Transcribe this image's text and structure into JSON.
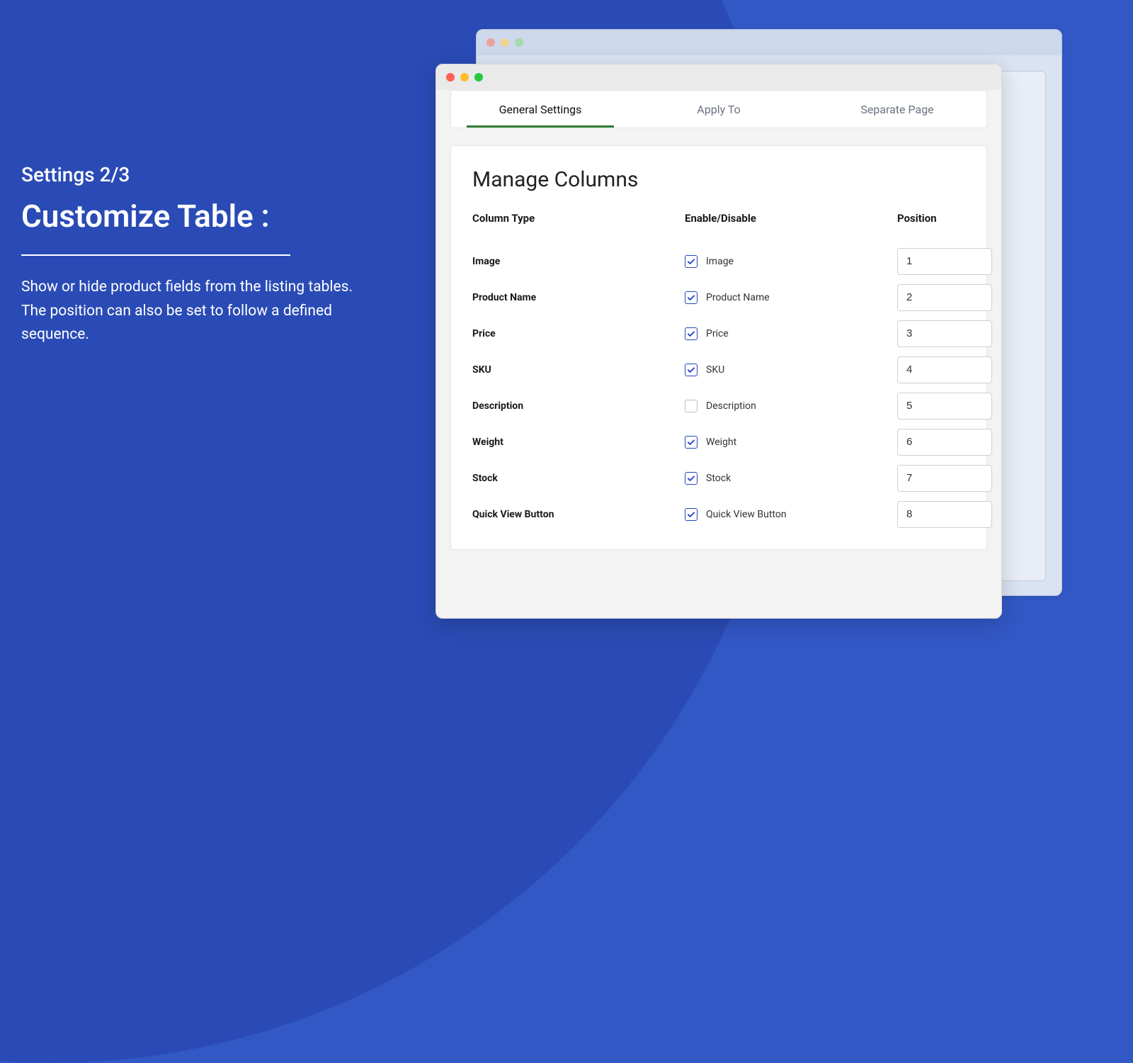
{
  "left": {
    "subtitle": "Settings 2/3",
    "title": "Customize Table :",
    "description": "Show or hide product fields from the listing tables. The position can also be set to follow a defined sequence."
  },
  "tabs": [
    {
      "label": "General Settings",
      "active": true
    },
    {
      "label": "Apply To",
      "active": false
    },
    {
      "label": "Separate Page",
      "active": false
    }
  ],
  "card": {
    "title": "Manage Columns",
    "headers": {
      "col1": "Column Type",
      "col2": "Enable/Disable",
      "col3": "Position"
    },
    "rows": [
      {
        "label": "Image",
        "enable_label": "Image",
        "checked": true,
        "position": "1"
      },
      {
        "label": "Product Name",
        "enable_label": "Product Name",
        "checked": true,
        "position": "2"
      },
      {
        "label": "Price",
        "enable_label": "Price",
        "checked": true,
        "position": "3"
      },
      {
        "label": "SKU",
        "enable_label": "SKU",
        "checked": true,
        "position": "4"
      },
      {
        "label": "Description",
        "enable_label": "Description",
        "checked": false,
        "position": "5"
      },
      {
        "label": "Weight",
        "enable_label": "Weight",
        "checked": true,
        "position": "6"
      },
      {
        "label": "Stock",
        "enable_label": "Stock",
        "checked": true,
        "position": "7"
      },
      {
        "label": "Quick View Button",
        "enable_label": "Quick View Button",
        "checked": true,
        "position": "8"
      }
    ]
  }
}
